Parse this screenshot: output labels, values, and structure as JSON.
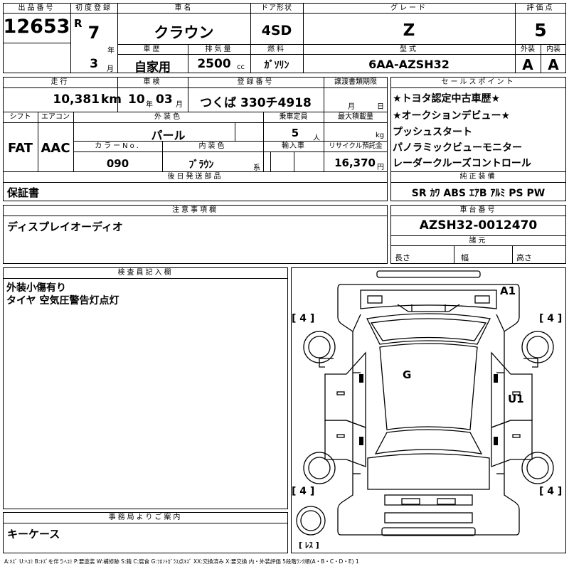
{
  "header": {
    "lot_label": "出品番号",
    "lot_no": "12653",
    "first_reg_label": "初度登録",
    "era": "R",
    "reg_year": "7",
    "year_unit": "年",
    "reg_month": "3",
    "month_unit": "月",
    "model_label": "車名",
    "model": "クラウン",
    "door_label": "ドア形状",
    "door": "4SD",
    "grade_label": "グレード",
    "grade": "Z",
    "score_label": "評価点",
    "score": "5",
    "history_label": "車歴",
    "history": "自家用",
    "disp_label": "排気量",
    "disp": "2500",
    "disp_unit": "cc",
    "fuel_label": "燃料",
    "fuel": "ｶﾞｿﾘﾝ",
    "type_label": "型式",
    "type": "6AA-AZSH32",
    "ext_label": "外装",
    "ext_grade": "A",
    "int_label": "内装",
    "int_grade": "A"
  },
  "row2": {
    "mileage_label": "走行",
    "mileage": "10,381",
    "mileage_unit": "km",
    "inspection_label": "車検",
    "insp_year": "10",
    "insp_year_unit": "年",
    "insp_month": "03",
    "insp_month_unit": "月",
    "plate_label": "登録番号",
    "plate": "つくば 330チ4918",
    "transfer_label": "譲渡書類期限",
    "transfer_month_unit": "月",
    "transfer_day_unit": "日",
    "shift_label": "シフト",
    "shift": "FAT",
    "ac_label": "エアコン",
    "ac": "AAC",
    "color_label": "外装色",
    "color": "パール",
    "capacity_label": "乗車定員",
    "capacity": "5",
    "capacity_unit": "人",
    "load_label": "最大積載量",
    "load_unit": "kg",
    "colorno_label": "カラーNo.",
    "colorno": "090",
    "interior_label": "内装色",
    "interior": "ﾌﾞﾗｳﾝ",
    "interior_unit": "系",
    "import_label": "輸入車",
    "recycle_label": "リサイクル預託金",
    "recycle": "16,370",
    "recycle_unit": "円",
    "later_label": "後日発送部品",
    "later": "保証書"
  },
  "sales": {
    "label": "セールスポイント",
    "points": [
      "★トヨタ認定中古車歴★",
      "★オークションデビュー★",
      "プッシュスタート",
      "パノラミックビューモニター",
      "レーダークルーズコントロール"
    ]
  },
  "equipment": {
    "label": "純正装備",
    "items": "SR ｶﾜ ABS ｴｱB ｱﾙﾐ PS PW"
  },
  "notes": {
    "label": "注意事項欄",
    "text": "ディスプレイオーディオ"
  },
  "chassis": {
    "label": "車台番号",
    "value": "AZSH32-0012470",
    "spec_label": "諸元",
    "len_label": "長さ",
    "width_label": "幅",
    "height_label": "高さ"
  },
  "inspector": {
    "label": "検査員記入欄",
    "lines": [
      "外装小傷有り",
      "タイヤ 空気圧警告灯点灯"
    ]
  },
  "diagram": {
    "tl": "[ 4 ]",
    "tr": "[ 4 ]",
    "bl": "[ 4 ]",
    "br": "[ 4 ]",
    "spare": "[ ﾚｽ ]",
    "mark_a1": "A1",
    "mark_g": "G",
    "mark_u1": "U1"
  },
  "office": {
    "label": "事務局よりご案内",
    "text": "キーケース"
  },
  "legend": "A:ｷｽﾞ  U:ﾍｺﾐ  B:ｷｽﾞを伴うﾍｺﾐ  P:要塗装  W:補修跡  S:錆  C:腐食  G:ﾌﾛﾝﾄｶﾞﾗｽ点ｷｽﾞ  XX:交換済み  X:要交換   内・外装評価  5段階ﾗﾝｸ順(A・B・C・D・E)  1"
}
